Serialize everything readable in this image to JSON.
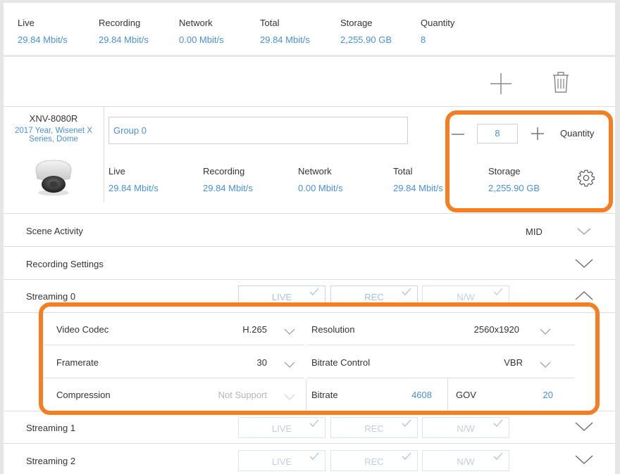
{
  "summary": {
    "items": [
      {
        "label": "Live",
        "value": "29.84 Mbit/s"
      },
      {
        "label": "Recording",
        "value": "29.84 Mbit/s"
      },
      {
        "label": "Network",
        "value": "0.00 Mbit/s"
      },
      {
        "label": "Total",
        "value": "29.84 Mbit/s"
      },
      {
        "label": "Storage",
        "value": "2,255.90 GB"
      },
      {
        "label": "Quantity",
        "value": "8"
      }
    ]
  },
  "toolbar": {
    "add_icon": "plus-icon",
    "delete_icon": "trash-icon"
  },
  "camera": {
    "model": "XNV-8080R",
    "description": "2017 Year, Wisenet X Series, Dome",
    "group": "Group 0",
    "quantity": "8",
    "quantity_label": "Quantity",
    "stats": [
      {
        "label": "Live",
        "value": "29.84 Mbit/s"
      },
      {
        "label": "Recording",
        "value": "29.84 Mbit/s"
      },
      {
        "label": "Network",
        "value": "0.00 Mbit/s"
      },
      {
        "label": "Total",
        "value": "29.84 Mbit/s"
      },
      {
        "label": "Storage",
        "value": "2,255.90 GB"
      }
    ]
  },
  "rows": {
    "scene_activity": {
      "label": "Scene Activity",
      "value": "MID"
    },
    "recording_settings": {
      "label": "Recording Settings"
    },
    "streaming0": {
      "label": "Streaming 0"
    },
    "streaming1": {
      "label": "Streaming 1"
    },
    "streaming2": {
      "label": "Streaming 2"
    }
  },
  "stream_buttons": {
    "live": "LIVE",
    "rec": "REC",
    "nw": "N/W"
  },
  "stream0_settings": {
    "video_codec": {
      "label": "Video Codec",
      "value": "H.265"
    },
    "resolution": {
      "label": "Resolution",
      "value": "2560x1920"
    },
    "framerate": {
      "label": "Framerate",
      "value": "30"
    },
    "bitrate_control": {
      "label": "Bitrate Control",
      "value": "VBR"
    },
    "compression": {
      "label": "Compression",
      "value": "Not Support"
    },
    "bitrate": {
      "label": "Bitrate",
      "value": "4608"
    },
    "gov": {
      "label": "GOV",
      "value": "20"
    }
  },
  "colors": {
    "accent": "#4a90d9",
    "highlight": "#f57e22",
    "divider": "#dcdcdc"
  }
}
